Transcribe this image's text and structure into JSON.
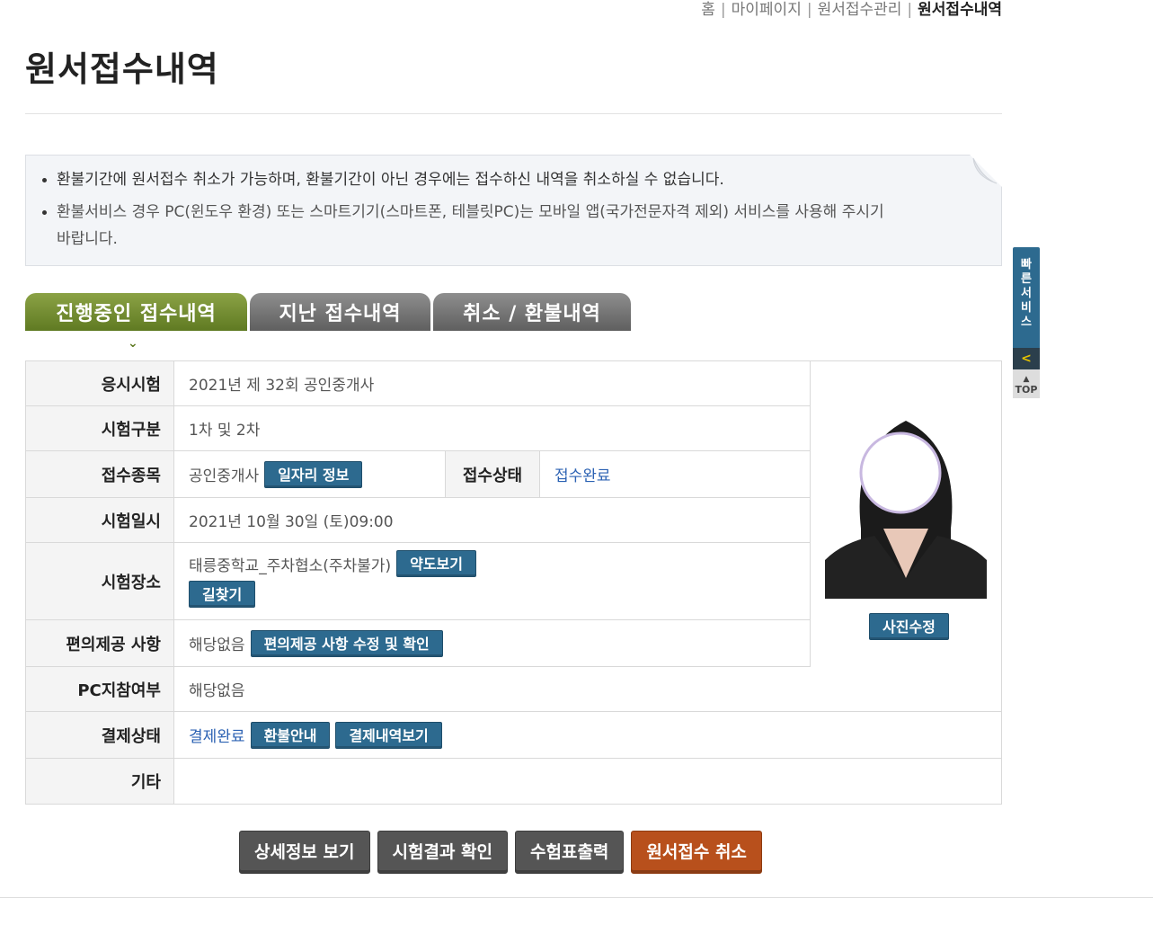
{
  "breadcrumb": [
    "홈",
    "마이페이지",
    "원서접수관리",
    "원서접수내역"
  ],
  "page_title": "원서접수내역",
  "notice": {
    "line1": "환불기간에 원서접수 취소가 가능하며, 환불기간이 아닌 경우에는 접수하신 내역을 취소하실 수 없습니다.",
    "line2": "환불서비스 경우 PC(윈도우 환경) 또는 스마트기기(스마트폰, 테블릿PC)는 모바일 앱(국가전문자격 제외) 서비스를 사용해 주시기 바랍니다."
  },
  "tabs": [
    "진행중인 접수내역",
    "지난 접수내역",
    "취소 / 환불내역"
  ],
  "tab_indicator": "⌄",
  "info": {
    "exam_label": "응시시험",
    "exam_value": "2021년 제 32회 공인중개사",
    "type_label": "시험구분",
    "type_value": "1차 및 2차",
    "category_label": "접수종목",
    "category_value": "공인중개사",
    "job_info_button": "일자리 정보",
    "status_label": "접수상태",
    "status_value": "접수완료",
    "datetime_label": "시험일시",
    "datetime_value": "2021년 10월 30일 (토)09:00",
    "place_label": "시험장소",
    "place_value": "태릉중학교_주차협소(주차불가)",
    "map_button": "약도보기",
    "directions_button": "길찾기",
    "convenience_label": "편의제공 사항",
    "convenience_value": "해당없음",
    "convenience_button": "편의제공 사항 수정 및 확인",
    "pc_label": "PC지참여부",
    "pc_value": "해당없음",
    "payment_label": "결제상태",
    "payment_value": "결제완료",
    "refund_button": "환불안내",
    "payment_history_button": "결제내역보기",
    "etc_label": "기타",
    "etc_value": ""
  },
  "photo_edit_button": "사진수정",
  "quick_service": {
    "label": "빠\n른\n서\n비\n스",
    "arrow": "<",
    "top": "TOP"
  },
  "actions": [
    "상세정보 보기",
    "시험결과 확인",
    "수험표출력",
    "원서접수 취소"
  ],
  "colors": {
    "tab_active": "#6e8a2c",
    "tab_inactive": "#767676",
    "button_blue": "#2d6a8f",
    "button_cancel": "#b8501c",
    "link_blue": "#2c62b3"
  }
}
